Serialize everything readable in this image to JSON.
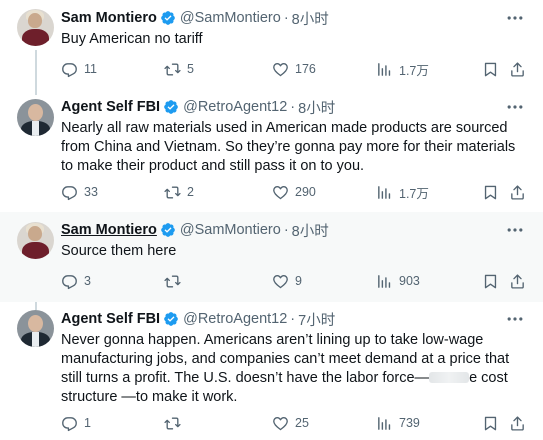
{
  "tweets": [
    {
      "author": "Sam Montiero",
      "handle": "@SamMontiero",
      "sep": "·",
      "time": "8小时",
      "text": "Buy American no tariff",
      "replies": "11",
      "retweets": "5",
      "likes": "176",
      "views": "1.7万"
    },
    {
      "author": "Agent Self FBI",
      "handle": "@RetroAgent12",
      "sep": "·",
      "time": "8小时",
      "text": "Nearly all raw materials used in American made products are sourced from China and Vietnam. So they’re gonna pay more for their materials to make their product and still pass it on to you.",
      "replies": "33",
      "retweets": "2",
      "likes": "290",
      "views": "1.7万"
    },
    {
      "author": "Sam Montiero",
      "handle": "@SamMontiero",
      "sep": "·",
      "time": "8小时",
      "text": "Source them here",
      "replies": "3",
      "retweets": "",
      "likes": "9",
      "views": "903"
    },
    {
      "author": "Agent Self FBI",
      "handle": "@RetroAgent12",
      "sep": "·",
      "time": "7小时",
      "text_a": "Never gonna happen. Americans aren’t lining up to take low-wage manufacturing jobs, and companies can’t meet demand at a price that still turns a profit. The U.S. doesn’t have the labor force—",
      "text_b": "e cost structure —to make it work.",
      "replies": "1",
      "retweets": "",
      "likes": "25",
      "views": "739"
    }
  ],
  "colors": {
    "verified": "#1d9bf0",
    "muted": "#536471",
    "highlight_bg": "#f7f9f9"
  },
  "icons": [
    "reply-icon",
    "retweet-icon",
    "like-icon",
    "views-icon",
    "bookmark-icon",
    "share-icon",
    "more-icon",
    "verified-icon"
  ]
}
